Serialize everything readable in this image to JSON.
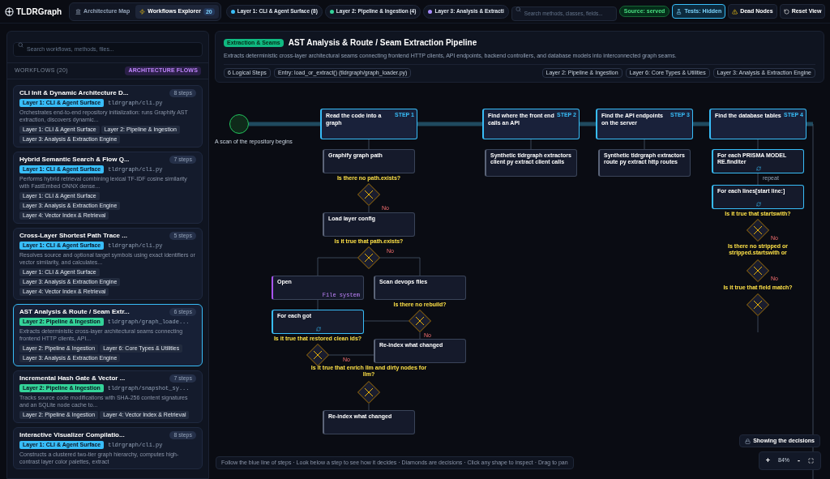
{
  "app": {
    "title": "TLDRGraph"
  },
  "nav_tabs": [
    {
      "label": "Architecture Map",
      "selected": false
    },
    {
      "label": "Workflows Explorer",
      "selected": true,
      "count": "20"
    }
  ],
  "layer_filters": [
    {
      "label": "Layer 1: CLI & Agent Surface (8)",
      "color": "#38bdf8"
    },
    {
      "label": "Layer 2: Pipeline & Ingestion (4)",
      "color": "#34d399"
    },
    {
      "label": "Layer 3: Analysis & Extracti",
      "color": "#a78bfa"
    }
  ],
  "search": {
    "placeholder": "Search methods, classes, fields..."
  },
  "source_badge": "Source: served",
  "toolbar_buttons": [
    {
      "label": "Tests: Hidden",
      "kind": "toggle",
      "selected": true
    },
    {
      "label": "Dead Nodes",
      "kind": "warning",
      "selected": false
    },
    {
      "label": "Reset View",
      "kind": "reset",
      "selected": false
    }
  ],
  "sidebar": {
    "search_placeholder": "Search workflows, methods, files...",
    "heading": "WORKFLOWS (20)",
    "mode_badge": "ARCHITECTURE FLOWS",
    "workflows": [
      {
        "title": "CLI Init & Dynamic Architecture D...",
        "steps": "8 steps",
        "layer": {
          "label": "Layer 1: CLI & Agent Surface",
          "color": "#38bdf8"
        },
        "file": "tldrgraph/cli.py",
        "description": "Orchestrates end-to-end repository initialization: runs Graphify AST extraction, discovers dynamic...",
        "tags": [
          "Layer 1: CLI & Agent Surface",
          "Layer 2: Pipeline & Ingestion",
          "Layer 3: Analysis & Extraction Engine"
        ],
        "selected": false
      },
      {
        "title": "Hybrid Semantic Search & Flow Q...",
        "steps": "7 steps",
        "layer": {
          "label": "Layer 1: CLI & Agent Surface",
          "color": "#38bdf8"
        },
        "file": "tldrgraph/cli.py",
        "description": "Performs hybrid retrieval combining lexical TF-IDF cosine similarity with FastEmbed ONNX dense...",
        "tags": [
          "Layer 1: CLI & Agent Surface",
          "Layer 3: Analysis & Extraction Engine",
          "Layer 4: Vector Index & Retrieval"
        ],
        "selected": false
      },
      {
        "title": "Cross-Layer Shortest Path Trace ...",
        "steps": "5 steps",
        "layer": {
          "label": "Layer 1: CLI & Agent Surface",
          "color": "#38bdf8"
        },
        "file": "tldrgraph/cli.py",
        "description": "Resolves source and optional target symbols using exact identifiers or vector similarity, and calculates...",
        "tags": [
          "Layer 1: CLI & Agent Surface",
          "Layer 3: Analysis & Extraction Engine",
          "Layer 4: Vector Index & Retrieval"
        ],
        "selected": false
      },
      {
        "title": "AST Analysis & Route / Seam Extr...",
        "steps": "6 steps",
        "layer": {
          "label": "Layer 2: Pipeline & Ingestion",
          "color": "#34d399"
        },
        "file": "tldrgraph/graph_loade...",
        "description": "Extracts deterministic cross-layer architectural seams connecting frontend HTTP clients, API...",
        "tags": [
          "Layer 2: Pipeline & Ingestion",
          "Layer 6: Core Types & Utilities",
          "Layer 3: Analysis & Extraction Engine"
        ],
        "selected": true
      },
      {
        "title": "Incremental Hash Gate & Vector ...",
        "steps": "7 steps",
        "layer": {
          "label": "Layer 2: Pipeline & Ingestion",
          "color": "#34d399"
        },
        "file": "tldrgraph/snapshot_sy...",
        "description": "Tracks source code modifications with SHA-256 content signatures and an SQLite node cache to...",
        "tags": [
          "Layer 2: Pipeline & Ingestion",
          "Layer 4: Vector Index & Retrieval"
        ],
        "selected": false
      },
      {
        "title": "Interactive Visualizer Compilatio...",
        "steps": "8 steps",
        "layer": {
          "label": "Layer 1: CLI & Agent Surface",
          "color": "#38bdf8"
        },
        "file": "tldrgraph/cli.py",
        "description": "Constructs a clustered two-tier graph hierarchy, computes high-contrast layer color palettes, extract",
        "selected": false
      }
    ]
  },
  "pipeline": {
    "category": "Extraction & Seams",
    "title": "AST Analysis & Route / Seam Extraction Pipeline",
    "description": "Extracts deterministic cross-layer architectural seams connecting frontend HTTP clients, API endpoints, backend controllers, and database models into interconnected graph seams.",
    "step_count": "6 Logical Steps",
    "entry": "Entry: load_or_extract() (tldrgraph/graph_loader.py)",
    "layers": [
      "Layer 2: Pipeline & Ingestion",
      "Layer 6: Core Types & Utilities",
      "Layer 3: Analysis & Extraction Engine"
    ]
  },
  "diagram": {
    "start_label": "A scan of the repository begins",
    "steps": [
      {
        "title": "Read the code into a graph",
        "badge": "STEP 1"
      },
      {
        "title": "Find where the front end calls an API",
        "badge": "STEP 2"
      },
      {
        "title": "Find the API endpoints on the server",
        "badge": "STEP 3"
      },
      {
        "title": "Find the database tables",
        "badge": "STEP 4"
      }
    ],
    "nodes": [
      {
        "text": "Graphify graph path",
        "kind": "plain"
      },
      {
        "text": "Load layer config",
        "kind": "plain"
      },
      {
        "text": "Open",
        "kind": "io",
        "note": "File system"
      },
      {
        "text": "Scan devops files",
        "kind": "plain"
      },
      {
        "text": "For each got",
        "kind": "loop"
      },
      {
        "text": "Re-index what changed",
        "kind": "plain"
      },
      {
        "text": "Re-index what changed",
        "kind": "plain"
      },
      {
        "text": "Synthetic tldrgraph extractors client py extract client calls",
        "kind": "plain"
      },
      {
        "text": "Synthetic tldrgraph extractors route py extract http routes",
        "kind": "plain"
      },
      {
        "text": "For each PRISMA MODEL RE.finditer",
        "kind": "loop"
      },
      {
        "text": "For each lines[start line:]",
        "kind": "loop"
      }
    ],
    "decisions": [
      {
        "question": "Is there no path.exists?"
      },
      {
        "question": "Is it true that path.exists?"
      },
      {
        "question": "Is there no rebuild?"
      },
      {
        "question": "Is it true that restored clean ids?"
      },
      {
        "question": "Is it true that enrich llm and dirty nodes for llm?"
      },
      {
        "question": "Is it true that startswith?"
      },
      {
        "question": "Is there no stripped or stripped.startswith or"
      },
      {
        "question": "Is it true that field match?"
      }
    ],
    "edge_labels": [
      {
        "text": "No",
        "kind": "branch"
      },
      {
        "text": "No",
        "kind": "branch"
      },
      {
        "text": "No",
        "kind": "branch"
      },
      {
        "text": "No",
        "kind": "branch"
      },
      {
        "text": "repeat",
        "kind": "loop"
      },
      {
        "text": "No",
        "kind": "branch"
      },
      {
        "text": "No",
        "kind": "branch"
      }
    ],
    "hint": "Follow the blue line of steps · Look below a step to see how it decides · Diamonds are decisions · Click any shape to inspect · Drag to pan",
    "decisions_button": "Showing the decisions",
    "zoom": {
      "zoom_in": "+",
      "level": "84%",
      "zoom_out": "-"
    }
  }
}
